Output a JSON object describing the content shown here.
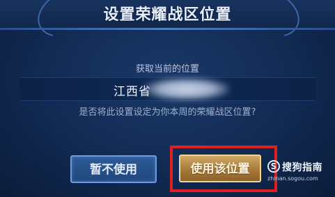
{
  "dialog": {
    "title": "设置荣耀战区位置",
    "subtitle": "获取当前的位置",
    "location_value": "江西省",
    "question": "是否将此设置设定为你本周的荣耀战区位置?"
  },
  "buttons": {
    "cancel_label": "暂不使用",
    "confirm_label": "使用该位置"
  },
  "watermark": {
    "icon": "S",
    "text": "搜狗指南",
    "url": "zhinan.sogou.com"
  },
  "colors": {
    "background": "#112a52",
    "confirm_button": "#a87a39",
    "cancel_button": "#21477c",
    "highlight": "#e0201e"
  }
}
